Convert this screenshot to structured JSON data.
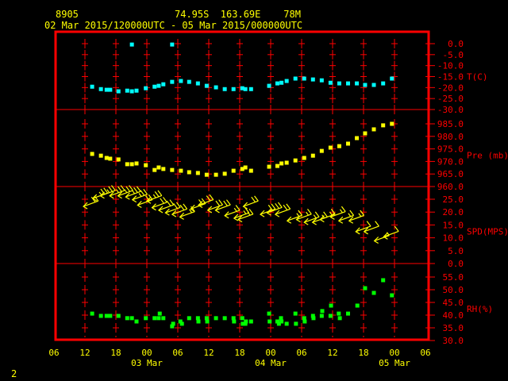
{
  "header": {
    "station_id": "8905",
    "location": "74.95S  163.69E    78M",
    "period": "02 Mar 2015/120000UTC - 05 Mar 2015/000000UTC"
  },
  "page_number": "2",
  "colors": {
    "frame": "#ff0000",
    "axis_text": "#ff0000",
    "time_text": "#ffff00",
    "temp": "#00ffff",
    "pressure": "#ffff00",
    "wind": "#ffff00",
    "rh": "#00ff00"
  },
  "chart_data": {
    "type": "scatter",
    "title": "8905 74.95S 163.69E 78M",
    "subtitle": "02 Mar 2015/120000UTC - 05 Mar 2015/000000UTC",
    "x_units": "hours since 02 Mar 2015 12UTC",
    "xlim": [
      -6,
      66
    ],
    "x_ticks": [
      {
        "h": -6,
        "label": "06"
      },
      {
        "h": 0,
        "label": "12"
      },
      {
        "h": 6,
        "label": "18"
      },
      {
        "h": 12,
        "label": "00"
      },
      {
        "h": 18,
        "label": "06"
      },
      {
        "h": 24,
        "label": "12"
      },
      {
        "h": 30,
        "label": "18"
      },
      {
        "h": 36,
        "label": "00"
      },
      {
        "h": 42,
        "label": "06"
      },
      {
        "h": 48,
        "label": "12"
      },
      {
        "h": 54,
        "label": "18"
      },
      {
        "h": 60,
        "label": "00"
      },
      {
        "h": 66,
        "label": "06"
      }
    ],
    "date_labels": [
      {
        "h": 12,
        "label": "03 Mar"
      },
      {
        "h": 36,
        "label": "04 Mar"
      },
      {
        "h": 60,
        "label": "05 Mar"
      }
    ],
    "grid": true,
    "panels": [
      {
        "name": "temperature",
        "label": "T(C)",
        "ylim": [
          -30,
          0
        ],
        "color": "#00ffff",
        "kind": "points",
        "ticks": [
          {
            "v": 0,
            "label": "0.0"
          },
          {
            "v": -5,
            "label": "-5.0"
          },
          {
            "v": -10,
            "label": "-10.0"
          },
          {
            "v": -15,
            "label": "-15.0"
          },
          {
            "v": -20,
            "label": "-20.0"
          },
          {
            "v": -25,
            "label": "-25.0"
          },
          {
            "v": -30,
            "label": "-30.0"
          }
        ],
        "x": [
          1.4,
          3.1,
          4.2,
          4.9,
          6.5,
          8.2,
          9.1,
          10.0,
          11.8,
          13.5,
          14.3,
          15.2,
          16.9,
          18.6,
          20.2,
          21.9,
          23.6,
          25.4,
          27.1,
          28.8,
          30.5,
          31.1,
          32.2,
          35.7,
          37.3,
          38.1,
          39.1,
          40.8,
          42.5,
          44.2,
          45.9,
          47.6,
          49.3,
          51.0,
          52.7,
          54.3,
          56.0,
          57.8,
          59.5,
          9.1,
          16.9
        ],
        "y": [
          -19.6,
          -20.7,
          -21.0,
          -21.0,
          -21.7,
          -21.4,
          -21.7,
          -21.4,
          -20.3,
          -19.6,
          -19.2,
          -18.5,
          -17.4,
          -17.0,
          -17.4,
          -18.1,
          -19.2,
          -19.9,
          -20.7,
          -20.7,
          -20.3,
          -20.7,
          -20.7,
          -19.2,
          -18.1,
          -17.8,
          -17.0,
          -15.9,
          -15.9,
          -16.3,
          -16.7,
          -17.8,
          -18.1,
          -18.1,
          -18.1,
          -18.8,
          -18.8,
          -18.1,
          -15.9,
          -0.4,
          -0.4
        ]
      },
      {
        "name": "pressure",
        "label": "Pre (mb)",
        "ylim": [
          960,
          985
        ],
        "color": "#ffff00",
        "kind": "points",
        "ticks": [
          {
            "v": 985,
            "label": "985.0"
          },
          {
            "v": 980,
            "label": "980.0"
          },
          {
            "v": 975,
            "label": "975.0"
          },
          {
            "v": 970,
            "label": "970.0"
          },
          {
            "v": 965,
            "label": "965.0"
          },
          {
            "v": 960,
            "label": "960.0"
          }
        ],
        "x": [
          1.4,
          3.1,
          4.2,
          4.9,
          6.5,
          8.2,
          9.1,
          10.0,
          11.8,
          13.5,
          14.3,
          15.2,
          16.9,
          18.6,
          20.2,
          21.9,
          23.6,
          25.4,
          27.1,
          28.8,
          30.5,
          31.1,
          32.2,
          35.7,
          37.3,
          38.1,
          39.1,
          40.8,
          42.5,
          44.2,
          45.9,
          47.6,
          49.3,
          51.0,
          52.7,
          54.3,
          56.0,
          57.8,
          59.5
        ],
        "y": [
          973.0,
          972.3,
          971.4,
          971.1,
          970.8,
          968.9,
          968.9,
          969.2,
          968.5,
          966.6,
          967.6,
          967.0,
          966.6,
          966.3,
          965.7,
          965.4,
          964.7,
          964.7,
          965.1,
          966.3,
          967.0,
          967.6,
          966.3,
          967.9,
          968.2,
          969.2,
          969.5,
          970.4,
          971.4,
          972.3,
          974.2,
          975.5,
          976.1,
          977.1,
          979.3,
          981.2,
          982.8,
          984.4,
          985.0
        ]
      },
      {
        "name": "wind_speed",
        "label": "SPD(MPS)",
        "ylim": [
          0,
          25
        ],
        "color": "#ffff00",
        "kind": "barbs",
        "ticks": [
          {
            "v": 25,
            "label": "25.0"
          },
          {
            "v": 20,
            "label": "20.0"
          },
          {
            "v": 15,
            "label": "15.0"
          },
          {
            "v": 10,
            "label": "10.0"
          },
          {
            "v": 5,
            "label": "5.0"
          },
          {
            "v": 0,
            "label": "0.0"
          }
        ],
        "x": [
          -0.3,
          1.5,
          3.0,
          4.8,
          6.4,
          7.9,
          9.2,
          10.2,
          12.0,
          13.0,
          14.3,
          15.6,
          16.9,
          18.4,
          20.5,
          22.0,
          23.8,
          25.3,
          27.1,
          28.9,
          29.7,
          30.7,
          34.0,
          35.3,
          36.9,
          39.2,
          41.0,
          42.5,
          44.1,
          45.6,
          47.6,
          49.2,
          51.2,
          52.5,
          54.1,
          56.1,
          57.9
        ],
        "y": [
          22.2,
          25.3,
          26.3,
          26.3,
          26.3,
          25.9,
          24.8,
          22.7,
          24.3,
          21.7,
          20.7,
          19.7,
          19.1,
          18.1,
          21.2,
          22.7,
          20.7,
          20.7,
          18.6,
          17.6,
          17.1,
          22.2,
          19.1,
          19.7,
          19.1,
          16.6,
          17.1,
          16.0,
          16.0,
          17.1,
          18.1,
          16.6,
          16.6,
          12.4,
          12.4,
          8.8,
          10.4
        ]
      },
      {
        "name": "relative_humidity",
        "label": "RH(%)",
        "ylim": [
          30,
          55
        ],
        "color": "#00ff00",
        "kind": "points",
        "ticks": [
          {
            "v": 55,
            "label": "55.0"
          },
          {
            "v": 50,
            "label": "50.0"
          },
          {
            "v": 45,
            "label": "45.0"
          },
          {
            "v": 40,
            "label": "40.0"
          },
          {
            "v": 35,
            "label": "35.0"
          },
          {
            "v": 30,
            "label": "30.0"
          }
        ],
        "x": [
          1.4,
          3.1,
          4.2,
          4.9,
          6.5,
          8.2,
          9.1,
          10.0,
          11.8,
          13.5,
          14.3,
          14.5,
          15.2,
          16.9,
          17.1,
          18.5,
          18.8,
          20.2,
          21.9,
          22.0,
          23.6,
          23.7,
          25.4,
          27.1,
          28.8,
          28.9,
          30.5,
          30.6,
          31.1,
          31.2,
          32.2,
          35.7,
          35.8,
          37.3,
          37.6,
          38.0,
          38.1,
          39.1,
          40.8,
          40.9,
          42.5,
          42.6,
          44.2,
          44.3,
          45.9,
          46.0,
          47.6,
          47.7,
          49.2,
          49.4,
          51.0,
          52.8,
          54.3,
          56.0,
          57.8,
          59.5
        ],
        "y": [
          40.6,
          39.7,
          39.7,
          39.7,
          39.7,
          38.8,
          38.8,
          37.5,
          38.8,
          38.8,
          38.8,
          40.6,
          38.8,
          35.6,
          36.6,
          37.5,
          36.6,
          38.8,
          38.8,
          37.5,
          38.8,
          37.5,
          38.8,
          38.8,
          38.8,
          37.5,
          38.8,
          36.6,
          36.6,
          37.5,
          37.5,
          40.6,
          37.5,
          37.5,
          36.6,
          38.8,
          37.5,
          36.6,
          40.6,
          36.6,
          38.8,
          37.5,
          39.7,
          38.8,
          39.7,
          41.6,
          39.7,
          43.75,
          40.6,
          38.8,
          40.6,
          43.75,
          50.6,
          48.75,
          53.75,
          47.8
        ]
      }
    ]
  }
}
